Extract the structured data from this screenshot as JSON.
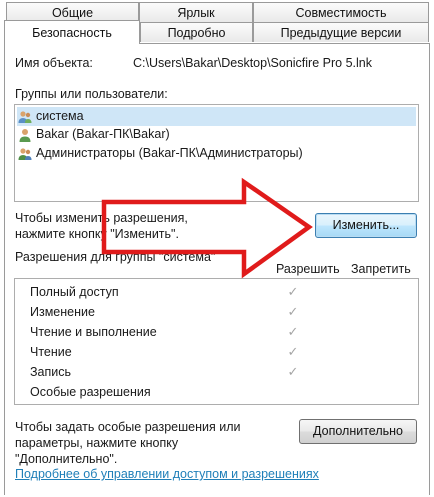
{
  "tabs": {
    "row1": [
      "Общие",
      "Ярлык",
      "Совместимость"
    ],
    "row2": [
      "Безопасность",
      "Подробно",
      "Предыдущие версии"
    ]
  },
  "object_name_label": "Имя объекта:",
  "object_name_value": "C:\\Users\\Bakar\\Desktop\\Sonicfire Pro 5.lnk",
  "groups_label": "Группы или пользователи:",
  "groups": [
    "система",
    "Bakar (Bakar-ПК\\Bakar)",
    "Администраторы (Bakar-ПК\\Администраторы)"
  ],
  "change_hint_line1": "Чтобы изменить разрешения,",
  "change_hint_line2": "нажмите кнопку \"Изменить\".",
  "change_button": "Изменить...",
  "perm_group_label": "Разрешения для группы \"система\"",
  "col_allow": "Разрешить",
  "col_deny": "Запретить",
  "permissions": [
    {
      "name": "Полный доступ",
      "allow": true
    },
    {
      "name": "Изменение",
      "allow": true
    },
    {
      "name": "Чтение и выполнение",
      "allow": true
    },
    {
      "name": "Чтение",
      "allow": true
    },
    {
      "name": "Запись",
      "allow": true
    },
    {
      "name": "Особые разрешения",
      "allow": false
    }
  ],
  "special_hint_line1": "Чтобы задать особые разрешения или",
  "special_hint_line2": "параметры, нажмите кнопку",
  "special_hint_line3": "\"Дополнительно\".",
  "advanced_button": "Дополнительно",
  "help_link": "Подробнее об управлении доступом и разрешениях",
  "check_glyph": "✓",
  "colors": {
    "selection": "#cfe6f7",
    "link": "#1f7fb8",
    "arrow": "#e01b1b"
  }
}
